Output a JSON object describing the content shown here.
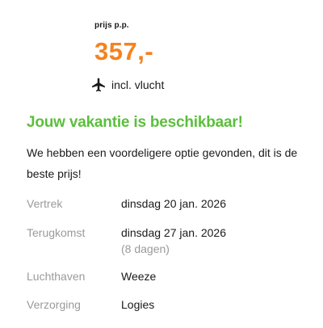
{
  "price": {
    "label": "prijs p.p.",
    "amount": "357,-"
  },
  "flight": {
    "icon": "airplane-icon",
    "label": "incl. vlucht"
  },
  "availability": {
    "headline": "Jouw vakantie is beschikbaar!",
    "description": "We hebben een voordeligere optie gevonden, dit is de beste prijs!"
  },
  "details": {
    "departure": {
      "label": "Vertrek",
      "value": "dinsdag 20 jan. 2026"
    },
    "return": {
      "label": "Terugkomst",
      "value": "dinsdag 27 jan. 2026",
      "duration": "(8 dagen)"
    },
    "airport": {
      "label": "Luchthaven",
      "value": "Weeze"
    },
    "board": {
      "label": "Verzorging",
      "value": "Logies"
    }
  },
  "colors": {
    "price": "#f6821f",
    "headline": "#5bbf3c",
    "muted": "#9a9a9a"
  }
}
